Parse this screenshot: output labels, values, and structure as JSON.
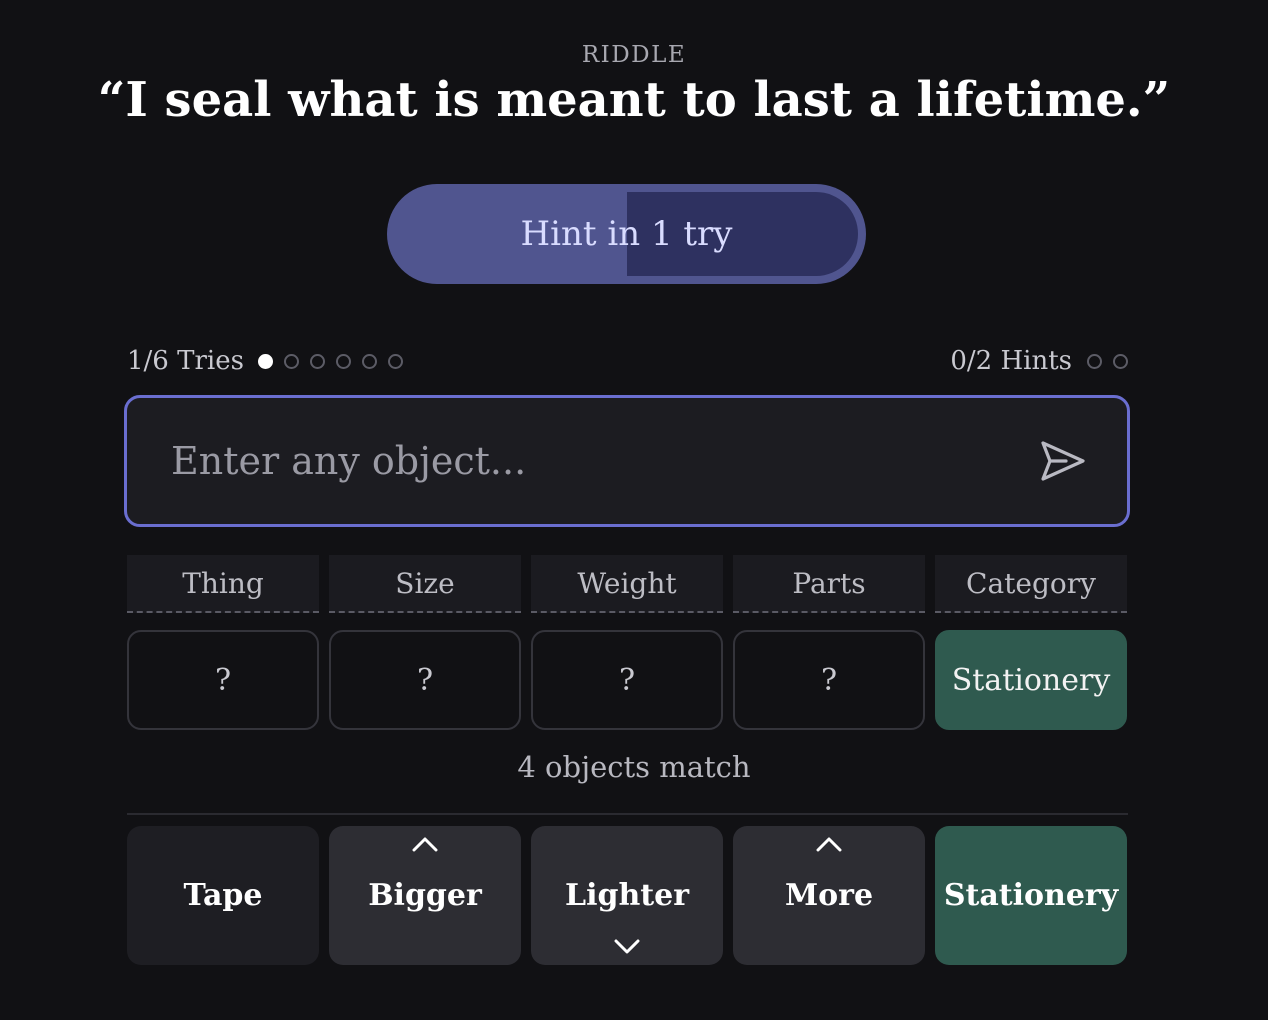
{
  "riddle": {
    "label": "RIDDLE",
    "text": "“I seal what is meant to last a lifetime.”"
  },
  "hint_button": {
    "label": "Hint in 1 try",
    "progress": 0.5
  },
  "status": {
    "tries_label": "1/6 Tries",
    "tries_used": 1,
    "tries_total": 6,
    "hints_label": "0/2 Hints",
    "hints_used": 0,
    "hints_total": 2
  },
  "guess_input": {
    "placeholder": "Enter any object...",
    "value": ""
  },
  "columns": [
    "Thing",
    "Size",
    "Weight",
    "Parts",
    "Category"
  ],
  "clues": [
    "?",
    "?",
    "?",
    "?",
    "Stationery"
  ],
  "match_count": "4 objects match",
  "last_guess": {
    "thing": "Tape",
    "size": "Bigger",
    "weight": "Lighter",
    "parts": "More",
    "category": "Stationery",
    "size_arrow": "up",
    "weight_arrow": "down",
    "parts_arrow": "up"
  },
  "colors": {
    "background": "#111114",
    "accent": "#6a6ed0",
    "hint_fill": "#50558f",
    "match": "#2f5a4f"
  },
  "icons": {
    "send": "send-icon",
    "up": "chevron-up-icon",
    "down": "chevron-down-icon"
  }
}
